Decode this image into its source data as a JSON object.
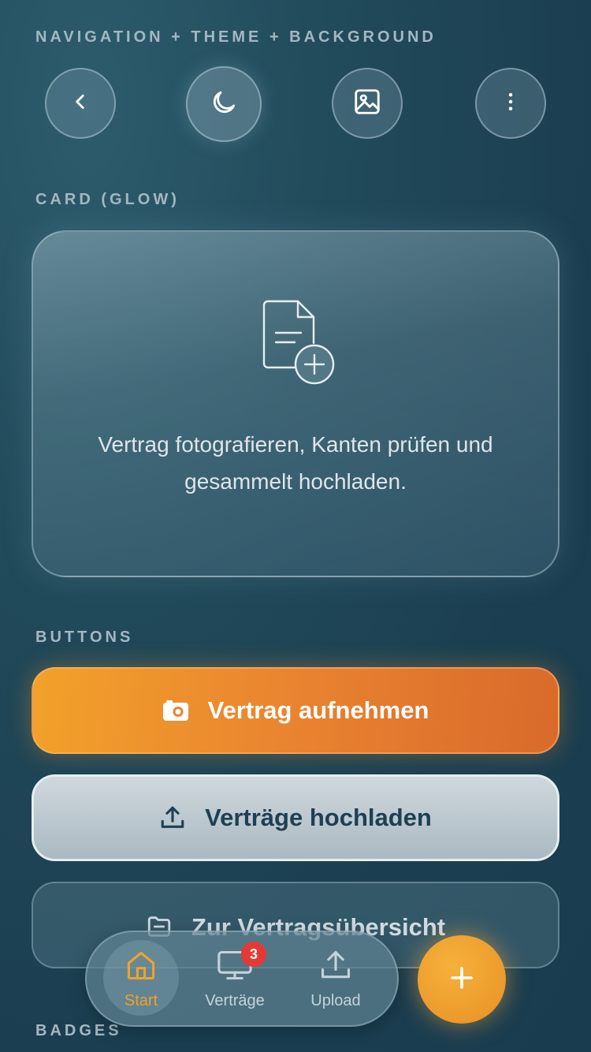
{
  "sections": {
    "navigation": "NAVIGATION + THEME + BACKGROUND",
    "card": "CARD (GLOW)",
    "buttons": "BUTTONS",
    "badges": "BADGES"
  },
  "nav_buttons": [
    {
      "icon": "chevron-left-icon"
    },
    {
      "icon": "moon-icon"
    },
    {
      "icon": "image-icon"
    },
    {
      "icon": "more-vertical-icon"
    }
  ],
  "card": {
    "icon": "document-add-icon",
    "text": "Vertrag fotografieren, Kanten prüfen und gesammelt hochladen."
  },
  "buttons": {
    "primary": {
      "label": "Vertrag aufnehmen",
      "icon": "camera-icon"
    },
    "secondary": {
      "label": "Verträge hochladen",
      "icon": "upload-icon"
    },
    "ghost": {
      "label": "Zur Vertragsübersicht",
      "icon": "folder-icon"
    }
  },
  "bottom_nav": {
    "items": [
      {
        "label": "Start",
        "icon": "home-icon",
        "active": true
      },
      {
        "label": "Verträge",
        "icon": "monitor-icon",
        "badge": "3"
      },
      {
        "label": "Upload",
        "icon": "upload-icon"
      }
    ],
    "fab_icon": "plus-icon"
  },
  "colors": {
    "accent": "#f2a12a",
    "badge": "#e53935",
    "background": "#1d4254"
  }
}
